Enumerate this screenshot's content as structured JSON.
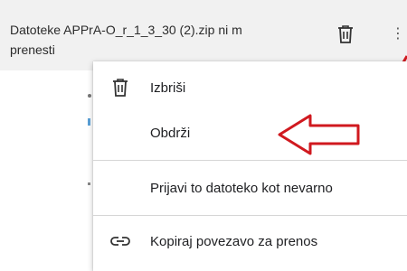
{
  "download": {
    "line1": "Datoteke APPrA-O_r_1_3_30 (2).zip ni m",
    "line2": "prenesti",
    "more_glyph": "⋮"
  },
  "menu": {
    "items": [
      {
        "label": "Izbriši",
        "icon": "trash-icon"
      },
      {
        "label": "Obdrži",
        "icon": ""
      },
      {
        "label": "Prijavi to datoteko kot nevarno",
        "icon": ""
      },
      {
        "label": "Kopiraj povezavo za prenos",
        "icon": "link-icon"
      }
    ]
  },
  "colors": {
    "bar_bg": "#f1f1f1",
    "annotation_red": "#d0191f",
    "menu_bg": "#ffffff"
  }
}
